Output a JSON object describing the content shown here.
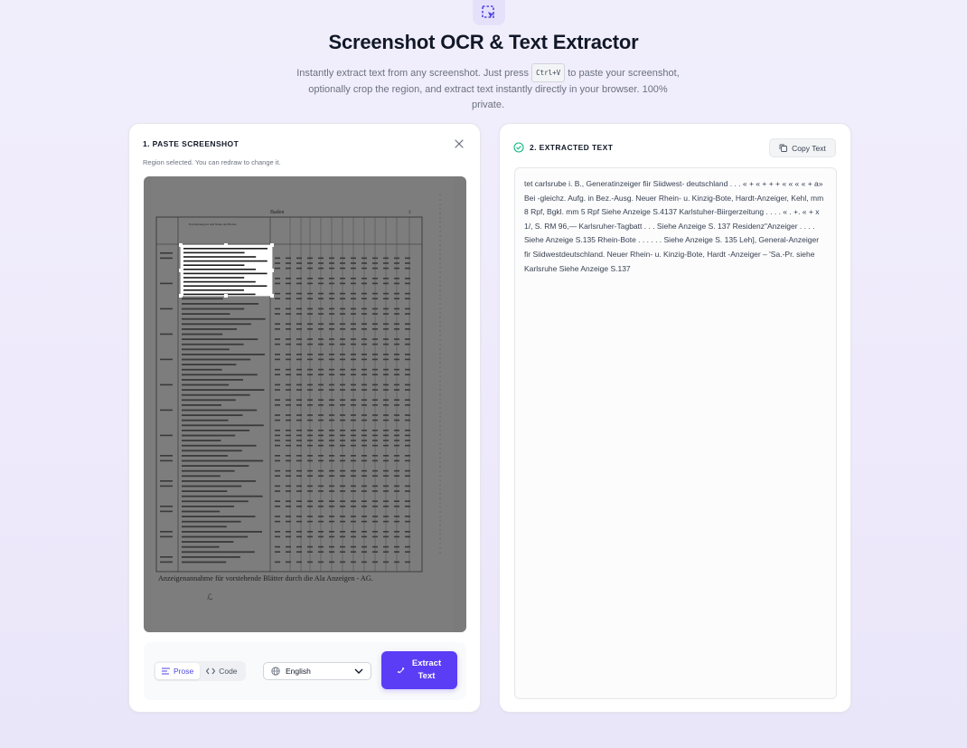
{
  "header": {
    "title": "Screenshot OCR & Text Extractor",
    "subtitle_before": "Instantly extract text from any screenshot. Just press",
    "shortcut": "Ctrl+V",
    "subtitle_after": "to paste your screenshot, optionally crop the region, and extract text instantly directly in your browser. 100% private."
  },
  "left_panel": {
    "title": "1. PASTE SCREENSHOT",
    "hint": "Region selected. You can redraw to change it.",
    "modes": {
      "prose": "Prose",
      "code": "Code",
      "selected": "Prose"
    },
    "language": {
      "selected": "English"
    },
    "extract_line1": "Extract",
    "extract_line2": "Text"
  },
  "right_panel": {
    "title": "2. EXTRACTED TEXT",
    "copy_label": "Copy Text",
    "output": "tet carlsrube i. B., Generatinzeiger fiir Siidwest- deutschland . . . « + « + + + « « « « + a» Bei -gleichz. Aufg. in Bez.-Ausg. Neuer Rhein- u. Kinzig-Bote, Hardt-Anzeiger, Kehl, mm 8 Rpf, Bgkl. mm 5 Rpf Siehe Anzeige S.4137 Karlstuher-Biirgerzeitung . . . . « . +. « + x 1/, S. RM 96,— Karlsruher-Tagbatt . . . Siehe Anzeige S. 137 Residenz\"Anzeiger . . . . Siehe Anzeige S.135 Rhein-Bote . . . . . . Siehe Anzeige S. 135 Leh], General-Anzeiger fir Siidwestdeutschland. Neuer Rhein- u. Kinzig-Bote, Hardt -Anzeiger – 'Sa.-Pr. siehe Karlsruhe Siehe Anzeige S.137"
  },
  "document": {
    "page_header": "Baden",
    "page_number": "3",
    "column_head_1": "Erscheinungsort und Name des Blattes",
    "footer": "Anzeigenannahme für vorstehende Blätter durch die Ala Anzeigen - AG.",
    "signature": "ℒ"
  },
  "colors": {
    "accent": "#5b3df5",
    "accent_text": "#4f46e5",
    "success": "#10b981"
  }
}
